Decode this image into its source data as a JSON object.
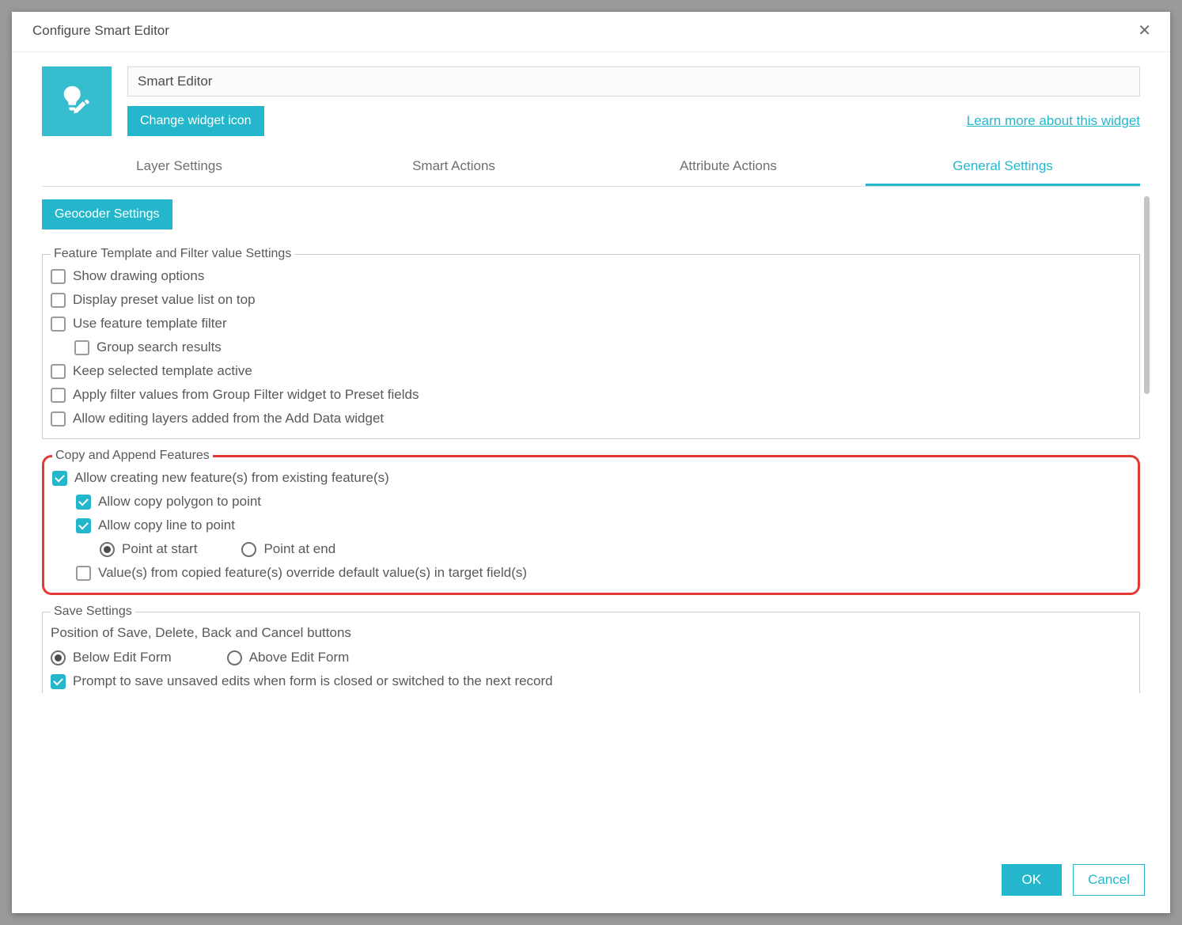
{
  "dialog": {
    "title": "Configure Smart Editor",
    "widget_name": "Smart Editor",
    "change_icon_btn": "Change widget icon",
    "learn_more": "Learn more about this widget"
  },
  "tabs": [
    {
      "label": "Layer Settings",
      "active": false
    },
    {
      "label": "Smart Actions",
      "active": false
    },
    {
      "label": "Attribute Actions",
      "active": false
    },
    {
      "label": "General Settings",
      "active": true
    }
  ],
  "geocoder_btn": "Geocoder Settings",
  "sections": {
    "template": {
      "legend": "Feature Template and Filter value Settings",
      "options": [
        {
          "label": "Show drawing options",
          "checked": false,
          "indent": 0
        },
        {
          "label": "Display preset value list on top",
          "checked": false,
          "indent": 0
        },
        {
          "label": "Use feature template filter",
          "checked": false,
          "indent": 0
        },
        {
          "label": "Group search results",
          "checked": false,
          "indent": 1
        },
        {
          "label": "Keep selected template active",
          "checked": false,
          "indent": 0
        },
        {
          "label": "Apply filter values from Group Filter widget to Preset fields",
          "checked": false,
          "indent": 0
        },
        {
          "label": "Allow editing layers added from the Add Data widget",
          "checked": false,
          "indent": 0
        }
      ]
    },
    "copy": {
      "legend": "Copy and Append Features",
      "allow_create": {
        "label": "Allow creating new feature(s) from existing feature(s)",
        "checked": true
      },
      "allow_poly_to_point": {
        "label": "Allow copy polygon to point",
        "checked": true
      },
      "allow_line_to_point": {
        "label": "Allow copy line to point",
        "checked": true
      },
      "point_radio": {
        "start": "Point at start",
        "end": "Point at end",
        "selected": "start"
      },
      "override": {
        "label": "Value(s) from copied feature(s) override default value(s) in target field(s)",
        "checked": false
      }
    },
    "save": {
      "legend": "Save Settings",
      "position_label": "Position of Save, Delete, Back and Cancel buttons",
      "position_radio": {
        "below": "Below Edit Form",
        "above": "Above Edit Form",
        "selected": "below"
      },
      "prompt": {
        "label": "Prompt to save unsaved edits when form is closed or switched to the next record",
        "checked": true
      }
    }
  },
  "footer": {
    "ok": "OK",
    "cancel": "Cancel"
  }
}
